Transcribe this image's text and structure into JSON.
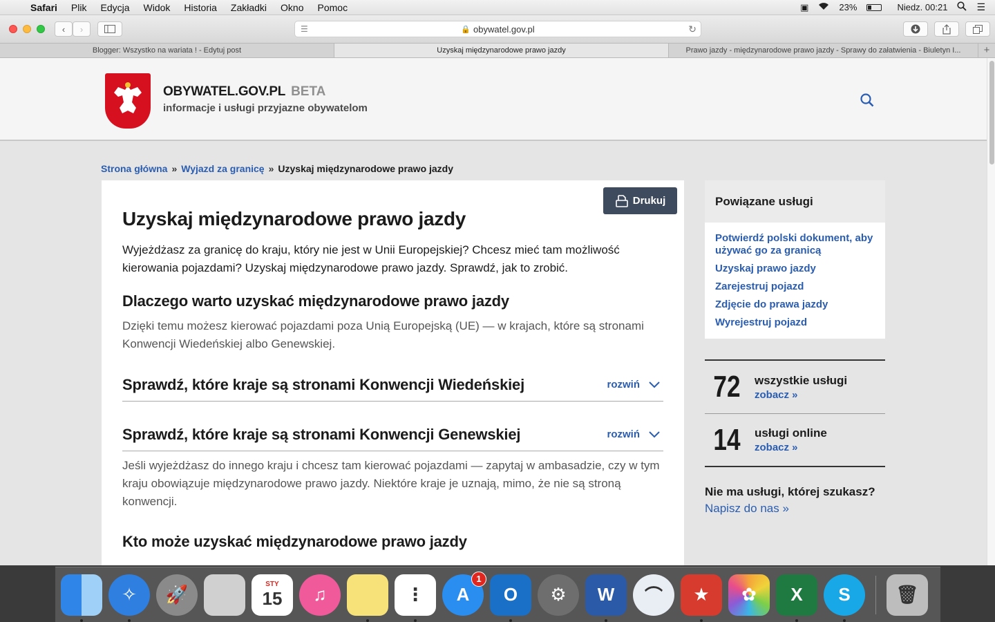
{
  "menubar": {
    "app": "Safari",
    "items": [
      "Plik",
      "Edycja",
      "Widok",
      "Historia",
      "Zakładki",
      "Okno",
      "Pomoc"
    ],
    "battery": "23%",
    "battery_level": 0.23,
    "clock": "Niedz. 00:21"
  },
  "browser": {
    "url": "obywatel.gov.pl",
    "tabs": [
      {
        "label": "Blogger: Wszystko na wariata ! - Edytuj post"
      },
      {
        "label": "Uzyskaj międzynarodowe prawo jazdy"
      },
      {
        "label": "Prawo jazdy - międzynarodowe prawo jazdy - Sprawy do załatwienia - Biuletyn I..."
      }
    ],
    "new_tab": "+"
  },
  "site": {
    "name": "OBYWATEL.GOV.PL",
    "beta": "BETA",
    "tagline": "informacje i usługi przyjazne obywatelom"
  },
  "breadcrumb": {
    "home": "Strona główna",
    "section": "Wyjazd za granicę",
    "current": "Uzyskaj międzynarodowe prawo jazdy",
    "sep": "»"
  },
  "article": {
    "print_label": "Drukuj",
    "title": "Uzyskaj międzynarodowe prawo jazdy",
    "lead": "Wyjeżdżasz za granicę do kraju, który nie jest w Unii Europejskiej? Chcesz mieć tam możliwość kierowania pojazdami? Uzyskaj międzynarodowe prawo jazdy. Sprawdź, jak to zrobić.",
    "why_heading": "Dlaczego warto uzyskać międzynarodowe prawo jazdy",
    "why_text": "Dzięki temu możesz kierować pojazdami poza Unią Europejską (UE) — w krajach, które są stronami Konwencji Wiedeńskiej albo Genewskiej.",
    "accordions": [
      {
        "title": "Sprawdź, które kraje są stronami Konwencji Wiedeńskiej",
        "toggle": "rozwiń"
      },
      {
        "title": "Sprawdź, które kraje są stronami Konwencji Genewskiej",
        "toggle": "rozwiń"
      }
    ],
    "other_text": "Jeśli wyjeżdżasz do innego kraju i chcesz tam kierować pojazdami — zapytaj w ambasadzie, czy w tym kraju obowiązuje międzynarodowe prawo jazdy. Niektóre kraje je uznają, mimo, że nie są stroną konwencji.",
    "who_heading": "Kto może uzyskać międzynarodowe prawo jazdy"
  },
  "sidebar": {
    "related_title": "Powiązane usługi",
    "related": [
      "Potwierdź polski dokument, aby używać go za granicą",
      "Uzyskaj prawo jazdy",
      "Zarejestruj pojazd",
      "Zdjęcie do prawa jazdy",
      "Wyrejestruj pojazd"
    ],
    "stats": [
      {
        "num": "72",
        "label": "wszystkie usługi",
        "link": "zobacz »"
      },
      {
        "num": "14",
        "label": "usługi online",
        "link": "zobacz »"
      }
    ],
    "missing_q": "Nie ma usługi, której szukasz?",
    "missing_a": "Napisz do nas »"
  },
  "dock": {
    "apps": [
      {
        "name": "finder-icon",
        "color": "#3a8ee6",
        "glyph": ""
      },
      {
        "name": "safari-icon",
        "color": "#2f7fe0",
        "glyph": "✧"
      },
      {
        "name": "launchpad-icon",
        "color": "#8a8a8a",
        "glyph": "🚀"
      },
      {
        "name": "calculator-icon",
        "color": "#d0d0d0",
        "glyph": ""
      },
      {
        "name": "calendar-icon",
        "color": "#ffffff",
        "glyph": "15",
        "month": "STY"
      },
      {
        "name": "itunes-icon",
        "color": "#f05a9a",
        "glyph": "♫"
      },
      {
        "name": "notes-icon",
        "color": "#f7e27a",
        "glyph": ""
      },
      {
        "name": "reminders-icon",
        "color": "#ffffff",
        "glyph": "⋮"
      },
      {
        "name": "app-store-icon",
        "color": "#2a8df0",
        "glyph": "A",
        "badge": "1"
      },
      {
        "name": "outlook-icon",
        "color": "#1a6fc7",
        "glyph": "O"
      },
      {
        "name": "system-preferences-icon",
        "color": "#6e6e6e",
        "glyph": "⚙"
      },
      {
        "name": "word-icon",
        "color": "#2b5aa8",
        "glyph": "W"
      },
      {
        "name": "airdrop-icon",
        "color": "#e9eef4",
        "glyph": "⌒"
      },
      {
        "name": "wunderlist-icon",
        "color": "#d73b2e",
        "glyph": "★"
      },
      {
        "name": "photos-icon",
        "color": "#f4a43a",
        "glyph": "✿"
      },
      {
        "name": "excel-icon",
        "color": "#1f7a42",
        "glyph": "X"
      },
      {
        "name": "skype-icon",
        "color": "#18a8e8",
        "glyph": "S"
      },
      {
        "name": "trash-icon",
        "color": "#bdbdbd",
        "glyph": "🗑"
      }
    ]
  },
  "colors": {
    "link": "#2a5db0",
    "print_button": "#3e4a5d",
    "emblem_red": "#d6101f"
  }
}
